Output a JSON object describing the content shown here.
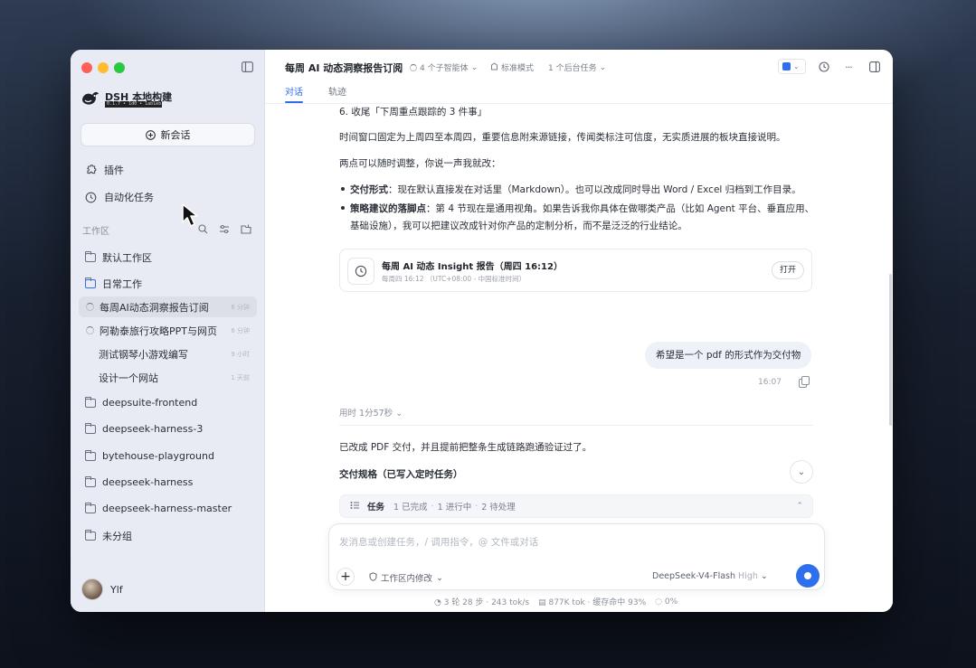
{
  "window": {
    "traffic_lights": [
      "#ff5f57",
      "#febc2e",
      "#28c840"
    ]
  },
  "sidebar": {
    "brand_title": "DSH 本地构建",
    "brand_subtitle": "0.1.7 • 1d0 • 1ab1eb133",
    "new_chat_label": "新会话",
    "nav": [
      {
        "icon": "plugin-icon",
        "label": "插件"
      },
      {
        "icon": "clock-icon",
        "label": "自动化任务"
      }
    ],
    "workspace_label": "工作区",
    "workspaces": {
      "default": "默认工作区",
      "daily": "日常工作",
      "chats": [
        {
          "label": "每周AI动态洞察报告订阅",
          "meta": "6 分钟"
        },
        {
          "label": "阿勒泰旅行攻略PPT与网页",
          "meta": "6 分钟"
        },
        {
          "label": "测试钢琴小游戏编写",
          "meta": "9 小时"
        },
        {
          "label": "设计一个网站",
          "meta": "1 天前"
        }
      ],
      "others": [
        "deepsuite-frontend",
        "deepseek-harness-3",
        "bytehouse-playground",
        "deepseek-harness",
        "deepseek-harness-master",
        "未分组"
      ]
    },
    "user_name": "Ylf"
  },
  "header": {
    "title": "每周 AI 动态洞察报告订阅",
    "agents": "4 个子智能体",
    "mode": "标准模式",
    "bg_tasks": "1 个后台任务",
    "tabs": [
      "对话",
      "轨迹"
    ]
  },
  "conversation": {
    "line1": "6. 收尾「下周重点跟踪的 3 件事」",
    "line2": "时间窗口固定为上周四至本周四，重要信息附来源链接，传闻类标注可信度，无实质进展的板块直接说明。",
    "line3": "两点可以随时调整，你说一声我就改：",
    "bullet1_label": "交付形式",
    "bullet1_text": "：现在默认直接发在对话里（Markdown）。也可以改成同时导出 Word / Excel 归档到工作目录。",
    "bullet2_label": "策略建议的落脚点",
    "bullet2_text": "：第 4 节现在是通用视角。如果告诉我你具体在做哪类产品（比如 Agent 平台、垂直应用、基础设施），我可以把建议改成针对你产品的定制分析，而不是泛泛的行业结论。",
    "card_title": "每周 AI 动态 Insight 报告（周四 16:12）",
    "card_subtitle": "每周四 16:12 （UTC+08:00 - 中国标准时间）",
    "card_open": "打开",
    "user_message": "希望是一个 pdf 的形式作为交付物",
    "user_time": "16:07",
    "duration": "用时 1分57秒",
    "reply1": "已改成 PDF 交付，并且提前把整条生成链路跑通验证过了。",
    "reply_heading": "交付规格（已写入定时任务）",
    "task_label": "任务",
    "task_done": "1 已完成",
    "task_running": "1 进行中",
    "task_pending": "2 待处理"
  },
  "composer": {
    "placeholder": "发消息或创建任务，/ 调用指令，@ 文件或对话",
    "permission": "工作区内修改",
    "model": "DeepSeek-V4-Flash",
    "effort": "High"
  },
  "status": {
    "steps": "3 轮 28 步 · 243 tok/s",
    "tokens": "877K tok · 缓存命中 93%",
    "context": "0%"
  },
  "colors": {
    "accent": "#2f6fec"
  }
}
